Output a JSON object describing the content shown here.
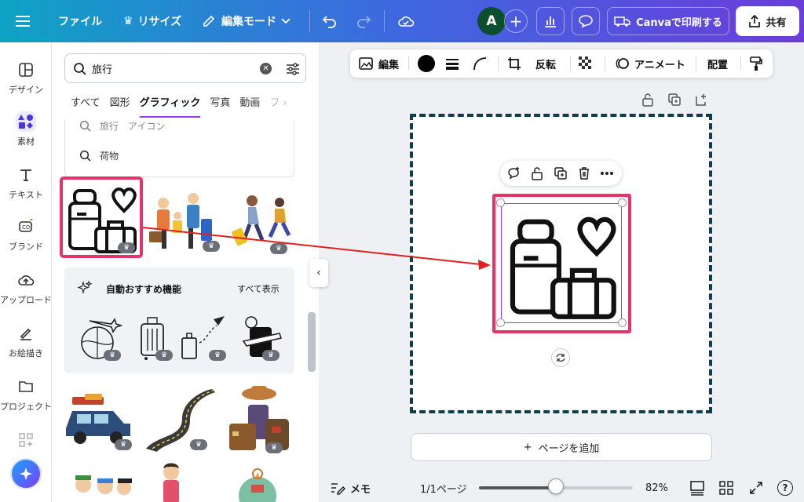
{
  "topbar": {
    "file_label": "ファイル",
    "resize_label": "リサイズ",
    "edit_mode_label": "編集モード",
    "avatar_initial": "A",
    "print_label": "Canvaで印刷する",
    "share_label": "共有"
  },
  "rail": {
    "items": [
      {
        "label": "デザイン"
      },
      {
        "label": "素材"
      },
      {
        "label": "テキスト"
      },
      {
        "label": "ブランド"
      },
      {
        "label": "アップロード"
      },
      {
        "label": "お絵描き"
      },
      {
        "label": "プロジェクト"
      }
    ]
  },
  "panel": {
    "search_value": "旅行",
    "tabs": [
      {
        "label": "すべて"
      },
      {
        "label": "図形"
      },
      {
        "label": "グラフィック"
      },
      {
        "label": "写真"
      },
      {
        "label": "動画"
      }
    ],
    "suggestions": [
      {
        "label": "旅行　アイコン"
      },
      {
        "label": "荷物"
      }
    ],
    "auto_title": "自動おすすめ機能",
    "auto_see_all": "すべて表示"
  },
  "ctx_bar": {
    "edit_label": "編集",
    "flip_label": "反転",
    "animate_label": "アニメート",
    "position_label": "配置"
  },
  "canvas": {
    "add_page_label": "ページを追加"
  },
  "bottombar": {
    "notes_label": "メモ",
    "page_count": "1/1ページ",
    "zoom": "82%",
    "zoom_fraction": 0.5
  },
  "colors": {
    "selection_highlight": "#e8336a",
    "arrow": "#e0201f",
    "accent": "#8b3dff"
  }
}
